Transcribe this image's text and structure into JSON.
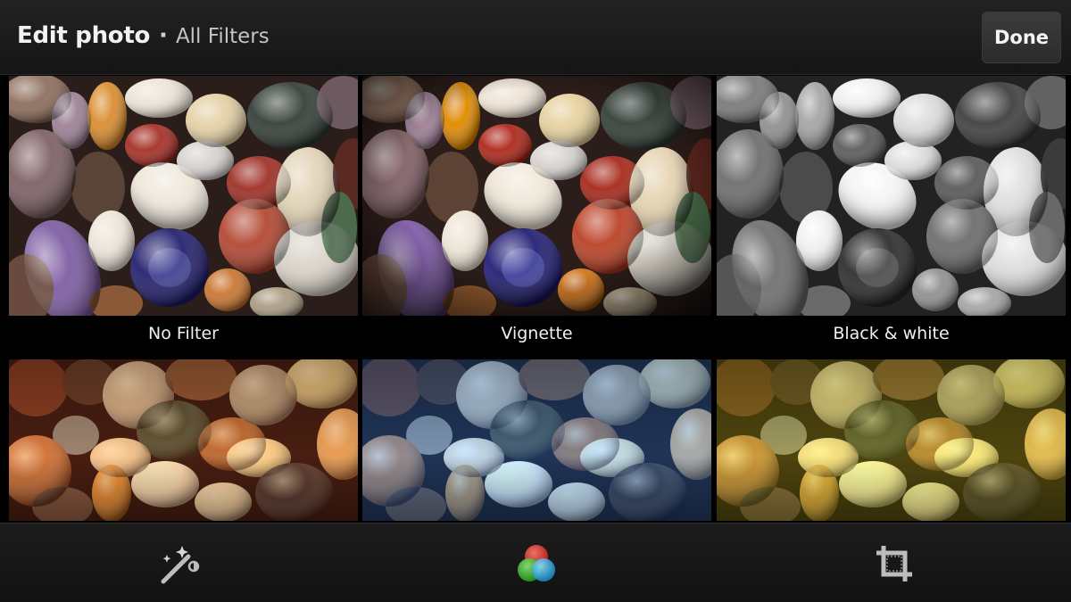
{
  "action_bar": {
    "title": "Edit photo",
    "separator": "·",
    "subtitle": "All Filters",
    "done_label": "Done"
  },
  "filters": [
    {
      "label": "No Filter",
      "effect": "none"
    },
    {
      "label": "Vignette",
      "effect": "vignette"
    },
    {
      "label": "Black & white",
      "effect": "grayscale"
    },
    {
      "label": "",
      "effect": "warm"
    },
    {
      "label": "",
      "effect": "cool-blue"
    },
    {
      "label": "",
      "effect": "yellow"
    }
  ],
  "toolbar": {
    "tools": [
      {
        "name": "auto-enhance",
        "icon": "magic-wand-icon"
      },
      {
        "name": "filters",
        "icon": "color-circles-icon",
        "selected": true
      },
      {
        "name": "crop",
        "icon": "crop-icon"
      }
    ]
  },
  "colors": {
    "background": "#000000",
    "bar": "#1a1a1a",
    "text_primary": "#f2f2f2",
    "text_secondary": "#c4c4c4",
    "circle_red": "#e0342c",
    "circle_green": "#3fbf3a",
    "circle_blue": "#2aa8e0"
  }
}
